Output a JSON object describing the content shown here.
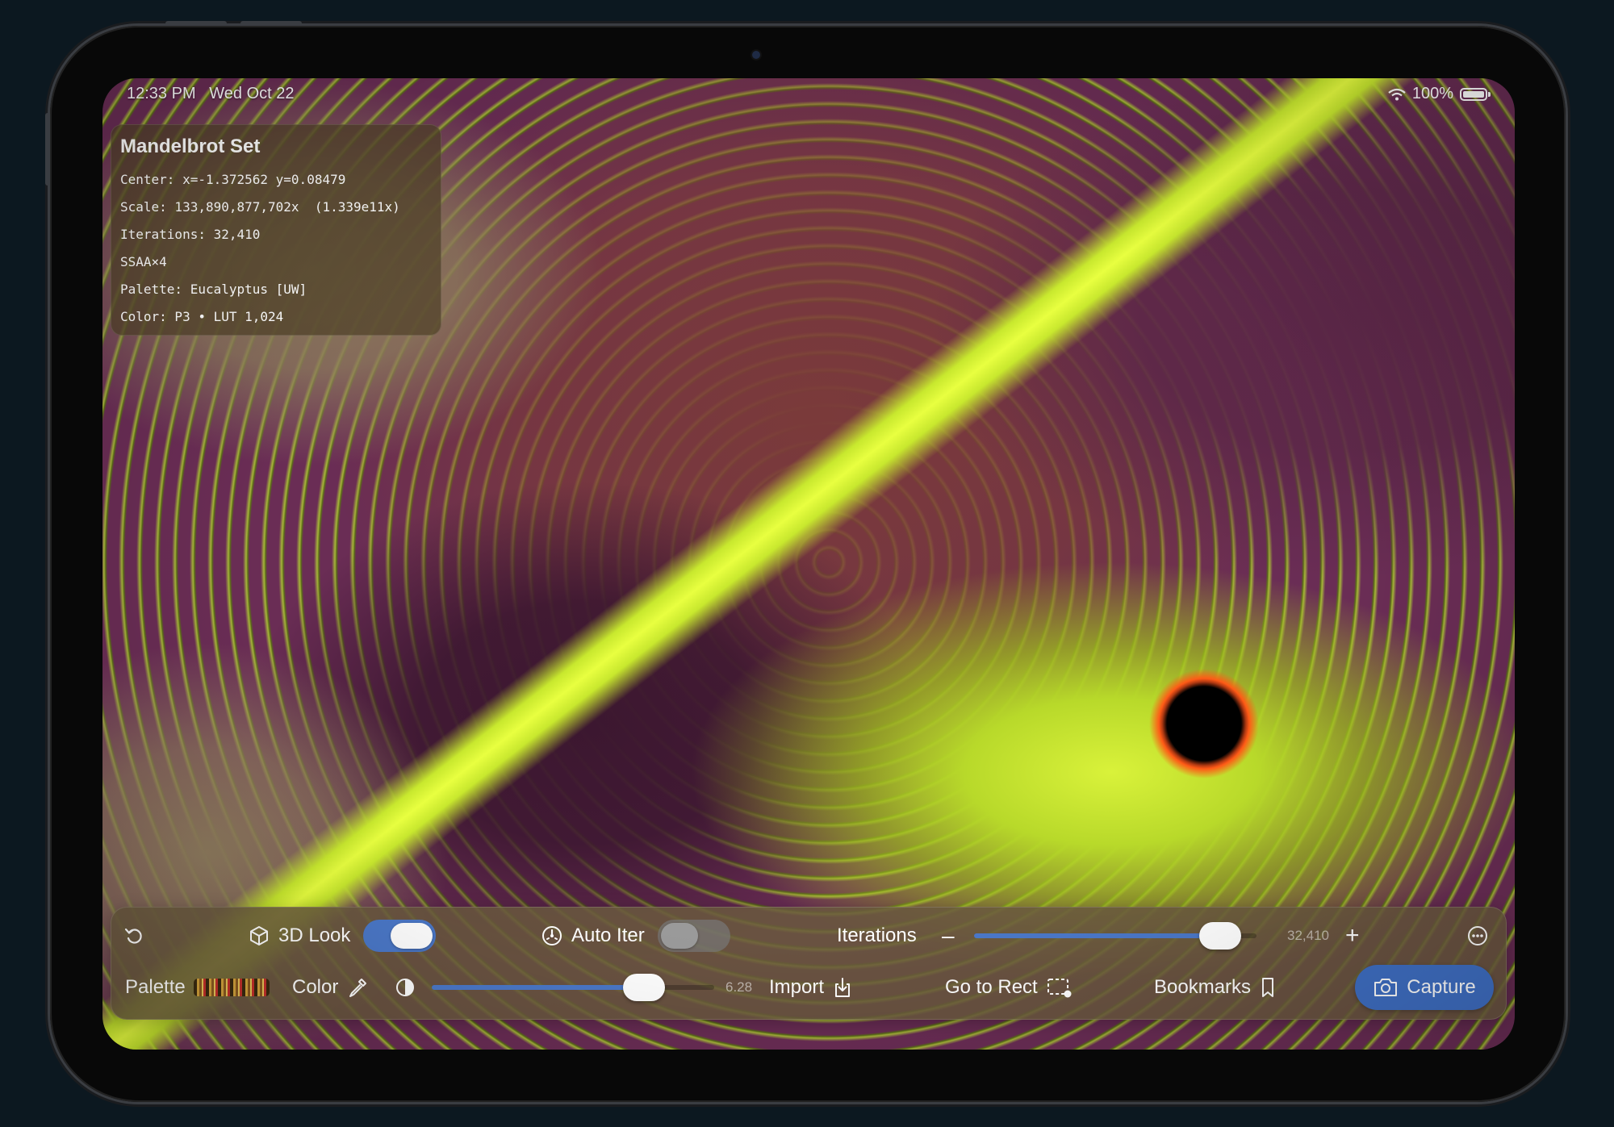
{
  "status_bar": {
    "time": "12:33 PM",
    "date": "Wed Oct 22",
    "battery": "100%"
  },
  "info_panel": {
    "title": "Mandelbrot Set",
    "center": "Center: x=-1.372562 y=0.08479",
    "scale": "Scale: 133,890,877,702x  (1.339e11x)",
    "iterations": "Iterations: 32,410",
    "ssaa": "SSAA×4",
    "palette": "Palette: Eucalyptus [UW]",
    "color": "Color: P3 • LUT 1,024"
  },
  "controls": {
    "reset_icon": "reset-icon",
    "look3d": {
      "label": "3D Look",
      "icon": "cube-icon",
      "on": true
    },
    "auto_iter": {
      "label": "Auto Iter",
      "icon": "gauge-icon",
      "on": false
    },
    "iterations": {
      "label": "Iterations",
      "value": "32,410",
      "fraction": 0.87,
      "minus": "–",
      "plus": "+"
    },
    "more_icon": "ellipsis-circle-icon",
    "palette": {
      "label": "Palette"
    },
    "color": {
      "label": "Color",
      "icon": "eyedropper-icon"
    },
    "contrast": {
      "icon": "contrast-icon",
      "value": "6.28",
      "fraction": 0.75
    },
    "import": {
      "label": "Import",
      "icon": "import-icon"
    },
    "go_to_rect": {
      "label": "Go to Rect",
      "icon": "select-rect-icon"
    },
    "bookmarks": {
      "label": "Bookmarks",
      "icon": "bookmark-icon"
    },
    "capture": {
      "label": "Capture",
      "icon": "camera-icon"
    }
  },
  "colors": {
    "accent": "#4b78c8",
    "panel": "#695840",
    "capture": "#3f6fc4"
  }
}
